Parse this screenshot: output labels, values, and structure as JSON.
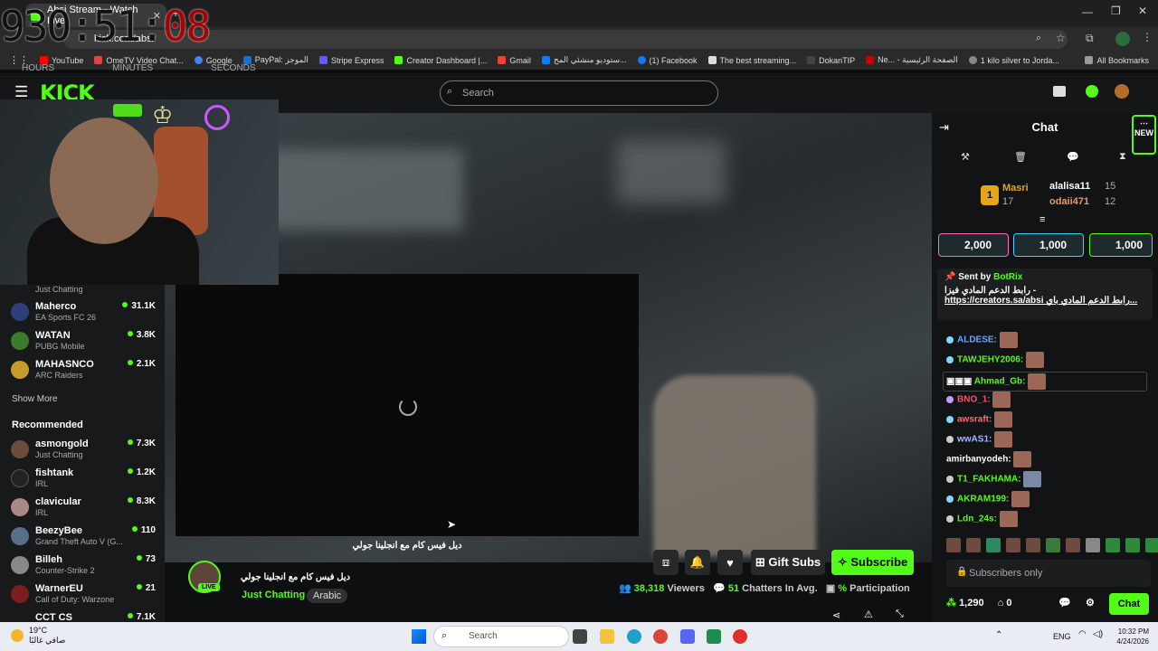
{
  "browser": {
    "tab_title": "Absi Stream - Watch Live",
    "url": "kick.com/absi",
    "bookmarks": [
      "YouTube",
      "OmeTV Video Chat...",
      "Google",
      "PayPal: الموجز",
      "Stripe Express",
      "Creator Dashboard |...",
      "Gmail",
      "ستوديو منشئي المح...",
      "(1) Facebook",
      "The best streaming...",
      "DokanTIP",
      "Ne... - الصفحة الرئيسية",
      "1 kilo silver to Jorda..."
    ],
    "all_bookmarks": "All Bookmarks"
  },
  "timer": {
    "hours": "930",
    "minutes": "51",
    "seconds": "08",
    "labels": [
      "HOURS",
      "MINUTES",
      "SECONDS"
    ]
  },
  "kick": {
    "logo": "KICK",
    "search_placeholder": "Search"
  },
  "sidebar": {
    "following": [
      {
        "name": "",
        "category": "Just Chatting",
        "viewers": ""
      },
      {
        "name": "Maherco",
        "category": "EA Sports FC 26",
        "viewers": "31.1K"
      },
      {
        "name": "WATAN",
        "category": "PUBG Mobile",
        "viewers": "3.8K"
      },
      {
        "name": "MAHASNCO",
        "category": "ARC Raiders",
        "viewers": "2.1K"
      }
    ],
    "show_more": "Show More",
    "recommended_title": "Recommended",
    "recommended": [
      {
        "name": "asmongold",
        "category": "Just Chatting",
        "viewers": "7.3K"
      },
      {
        "name": "fishtank",
        "category": "IRL",
        "viewers": "1.2K"
      },
      {
        "name": "clavicular",
        "category": "IRL",
        "viewers": "8.3K"
      },
      {
        "name": "BeezyBee",
        "category": "Grand Theft Auto V (G...",
        "viewers": "110"
      },
      {
        "name": "Billeh",
        "category": "Counter-Strike 2",
        "viewers": "73"
      },
      {
        "name": "WarnerEU",
        "category": "Call of Duty: Warzone",
        "viewers": "21"
      },
      {
        "name": "CCT CS",
        "category": "",
        "viewers": "7.1K"
      }
    ]
  },
  "player": {
    "overlay_caption": "ديل فيس كام مع انجلينا جولي"
  },
  "stream": {
    "title": "ديل فيس كام مع انجلينا جولي",
    "live": "LIVE",
    "category": "Just Chatting",
    "tag": "Arabic",
    "gift_subs": "Gift Subs",
    "subscribe": "Subscribe",
    "viewers": "38,318",
    "viewers_label": "Viewers",
    "chatters": "51",
    "chatters_label": "Chatters In Avg.",
    "participation": "%",
    "participation_label": "Participation"
  },
  "chat": {
    "title": "Chat",
    "new_badge": "NEW",
    "leaderboard": {
      "first": {
        "name": "Masri",
        "count": "17"
      },
      "second": {
        "name": "alalisa11",
        "count": "15"
      },
      "third": {
        "name": "odaii471",
        "count": "12"
      }
    },
    "gift_goals": [
      "2,000",
      "1,000",
      "1,000"
    ],
    "pinned": {
      "sent_by": "Sent by",
      "bot": "BotRix",
      "text": "رابط الدعم المادي فيزا -",
      "link": "https://creators.sa/absi رابط الدعم المادي باي..."
    },
    "messages": [
      {
        "user": "ALDESE:",
        "color": "#6aa7ff"
      },
      {
        "user": "TAWJEHY2006:",
        "color": "#53fc18"
      },
      {
        "user": "Ahmad_Gb:",
        "color": "#53fc18"
      },
      {
        "user": "BNO_1:",
        "color": "#ff4d6a"
      },
      {
        "user": "awsraft:",
        "color": "#ff6a6a"
      },
      {
        "user": "wwAS1:",
        "color": "#a8b8ff"
      },
      {
        "user": "amirbanyodeh:",
        "color": "#ffffff"
      },
      {
        "user": "T1_FAKHAMA:",
        "color": "#53fc18"
      },
      {
        "user": "AKRAM199:",
        "color": "#53fc18"
      },
      {
        "user": "Ldn_24s:",
        "color": "#53fc18"
      }
    ],
    "input_placeholder": "Subscribers only",
    "points": "1,290",
    "streak": "0",
    "send": "Chat"
  },
  "taskbar": {
    "weather_temp": "19°C",
    "weather_desc": "صافي غالبًا",
    "search": "Search",
    "lang": "ENG",
    "time": "10:32 PM",
    "date": "4/24/2026"
  }
}
